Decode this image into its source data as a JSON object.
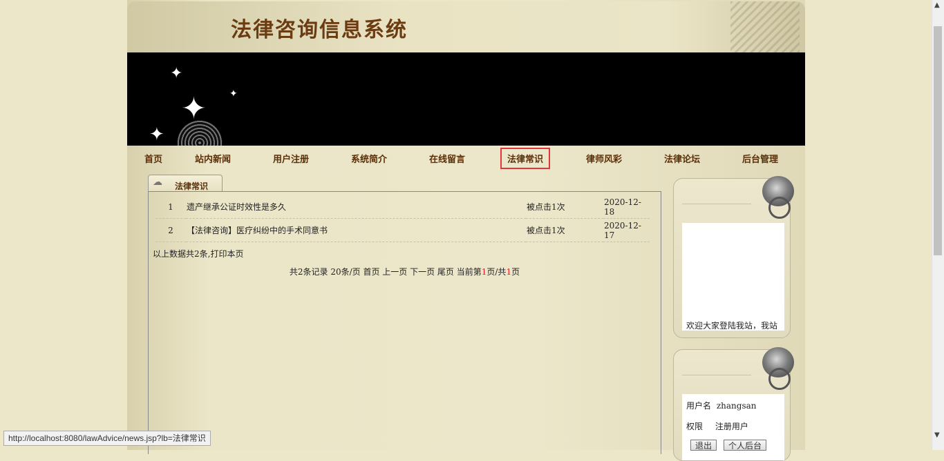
{
  "header": {
    "title": "法律咨询信息系统"
  },
  "nav": {
    "items": [
      {
        "label": "首页"
      },
      {
        "label": "站内新闻"
      },
      {
        "label": "用户注册"
      },
      {
        "label": "系统简介"
      },
      {
        "label": "在线留言"
      },
      {
        "label": "法律常识"
      },
      {
        "label": "律师风彩"
      },
      {
        "label": "法律论坛"
      },
      {
        "label": "后台管理"
      }
    ],
    "active": "法律常识"
  },
  "main": {
    "tab_label": "法律常识",
    "rows": [
      {
        "index": "1",
        "title": "遗产继承公证时效性是多久",
        "clicks": "被点击1次",
        "date": "2020-12-18"
      },
      {
        "index": "2",
        "title": "【法律咨询】医疗纠纷中的手术同意书",
        "clicks": "被点击1次",
        "date": "2020-12-17"
      }
    ],
    "summary": "以上数据共2条,打印本页",
    "pager": {
      "prefix": "共2条记录  20条/页 首页 上一页 下一页 尾页 当前第",
      "current": "1",
      "mid": "页/共",
      "total": "1",
      "suffix": "页"
    }
  },
  "sidebar": {
    "announcement_text": "欢迎大家登陆我站，我站",
    "user": {
      "username_label": "用户名",
      "username": "zhangsan",
      "role_label": "权限",
      "role": "注册用户",
      "logout_label": "退出",
      "backend_label": "个人后台"
    }
  },
  "status_bar": {
    "url": "http://localhost:8080/lawAdvice/news.jsp?lb=法律常识"
  },
  "colors": {
    "page_bg": "#ece7c9",
    "nav_text": "#5a2e06",
    "title_text": "#6b3b12",
    "active_outline": "#e0383a",
    "pager_highlight": "#e21a1a"
  }
}
